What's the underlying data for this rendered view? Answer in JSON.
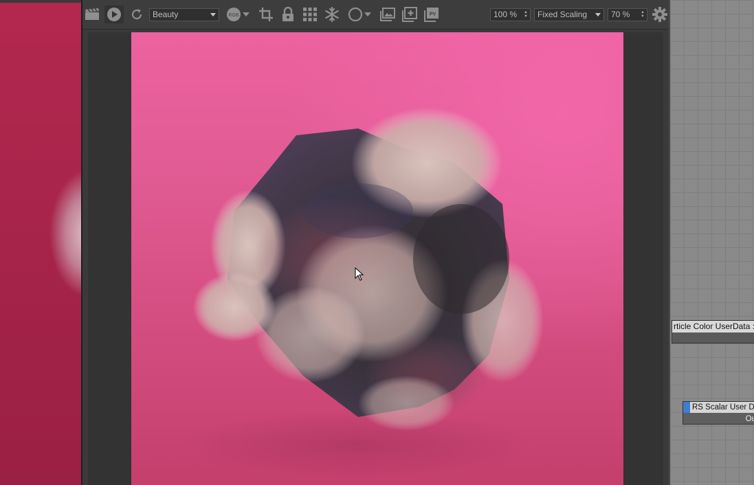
{
  "toolbar": {
    "icons": [
      "clapper-icon",
      "play-icon",
      "refresh-icon",
      "rgb-icon",
      "crop-icon",
      "lock-icon",
      "grid-icon",
      "snowflake-icon",
      "circle-icon",
      "image-icon",
      "add-image-icon",
      "pv-icon",
      "gear-icon"
    ],
    "aov_select": "Beauty",
    "rgb_label": "RGB",
    "pv_label": "PV",
    "zoom_value": "100 %",
    "scaling_mode": "Fixed Scaling",
    "scale_value": "70 %"
  },
  "node_editor": {
    "particle_node_title": "rticle Color UserData : Co",
    "scalar_node_title": "RS Scalar User Dat",
    "scalar_node_port": "Ou"
  },
  "colors": {
    "background_pink": "#e05a92",
    "toolbar": "#3d3d3d",
    "accent_blue": "#3c7fd1"
  }
}
